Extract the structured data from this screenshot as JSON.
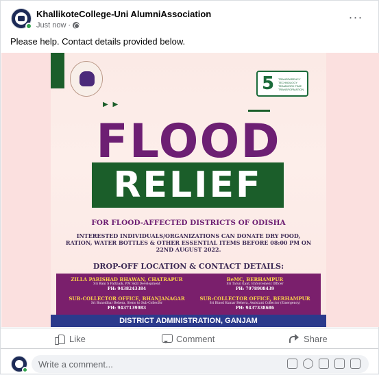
{
  "post": {
    "group_name": "KhallikoteCollege-Uni AlumniAssociation",
    "timestamp": "Just now",
    "dot": "·",
    "more_label": "···",
    "text": "Please help. Contact details provided below."
  },
  "poster": {
    "title_top": "FLOOD",
    "title_bottom": "RELIEF",
    "subtitle": "FOR FLOOD-AFFECTED DISTRICTS OF ODISHA",
    "body_line1": "INTERESTED INDIVIDUALS/ORGANIZATIONS CAN DONATE DRY FOOD,",
    "body_line2": "RATION, WATER BOTTLES & OTHER ESSENTIAL ITEMS BEFORE 08:00 PM ON",
    "body_line3": "22ND AUGUST 2022.",
    "dropoff_heading": "DROP-OFF LOCATION & CONTACT DETAILS:",
    "logo_number": "5",
    "logo_text": "TRANSPARENCY TECHNOLOGY TEAMWORK TIME TRANSFORMATION",
    "contacts": [
      {
        "location": "ZILLA PARISHAD BHAWAN, CHATRAPUR",
        "person": "Sri Bani S Pattnaik, P.M Skill Development",
        "phone": "PH: 9438243384"
      },
      {
        "location": "BeMC, BERHAMPUR",
        "person": "Sri Tarun Kant, Enforcement Officer",
        "phone": "PH: 7978908439"
      },
      {
        "location": "SUB-COLLECTOR OFFICE, BHANJANAGAR",
        "person": "Sri Banoidhar Behera, Steno to Sub-Collector",
        "phone": "PH: 9437139983"
      },
      {
        "location": "SUB-COLLECTOR OFFICE, BERHAMPUR",
        "person": "Sri Binod Kumar Behera, Assistant Collector (Emergency)",
        "phone": "PH: 9437338686"
      }
    ],
    "footer": "DISTRICT ADMINISTRATION, GANJAM"
  },
  "actions": {
    "like": "Like",
    "comment": "Comment",
    "share": "Share"
  },
  "comment_box": {
    "placeholder": "Write a comment..."
  },
  "colors": {
    "accent_purple": "#6d1f73",
    "accent_green": "#1b5e2a",
    "footer_blue": "#2b3a8c",
    "online_green": "#31a24c"
  }
}
